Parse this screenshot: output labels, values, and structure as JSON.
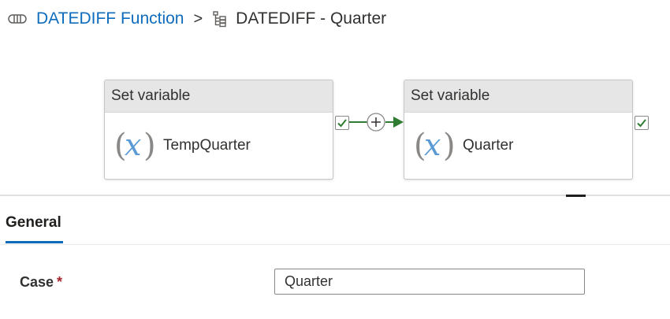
{
  "breadcrumb": {
    "pipeline_icon": "pipeline-icon",
    "pipeline_name": "DATEDIFF Function",
    "separator": ">",
    "activity_icon": "activity-list-icon",
    "activity_name": "DATEDIFF - Quarter"
  },
  "canvas": {
    "activities": [
      {
        "type": "Set variable",
        "icon": "variable-icon",
        "name": "TempQuarter"
      },
      {
        "type": "Set variable",
        "icon": "variable-icon",
        "name": "Quarter"
      }
    ],
    "connector": {
      "type": "success",
      "add_icon": "plus-icon",
      "color": "#2e7d32"
    }
  },
  "panel": {
    "tabs": [
      {
        "label": "General",
        "active": true
      }
    ],
    "fields": [
      {
        "label": "Case",
        "required": true,
        "required_marker": "*",
        "value": "Quarter"
      }
    ]
  },
  "colors": {
    "accent": "#0f6cbd",
    "success": "#2e7d32",
    "required": "#a4262c",
    "activity_header": "#e6e6e6"
  }
}
